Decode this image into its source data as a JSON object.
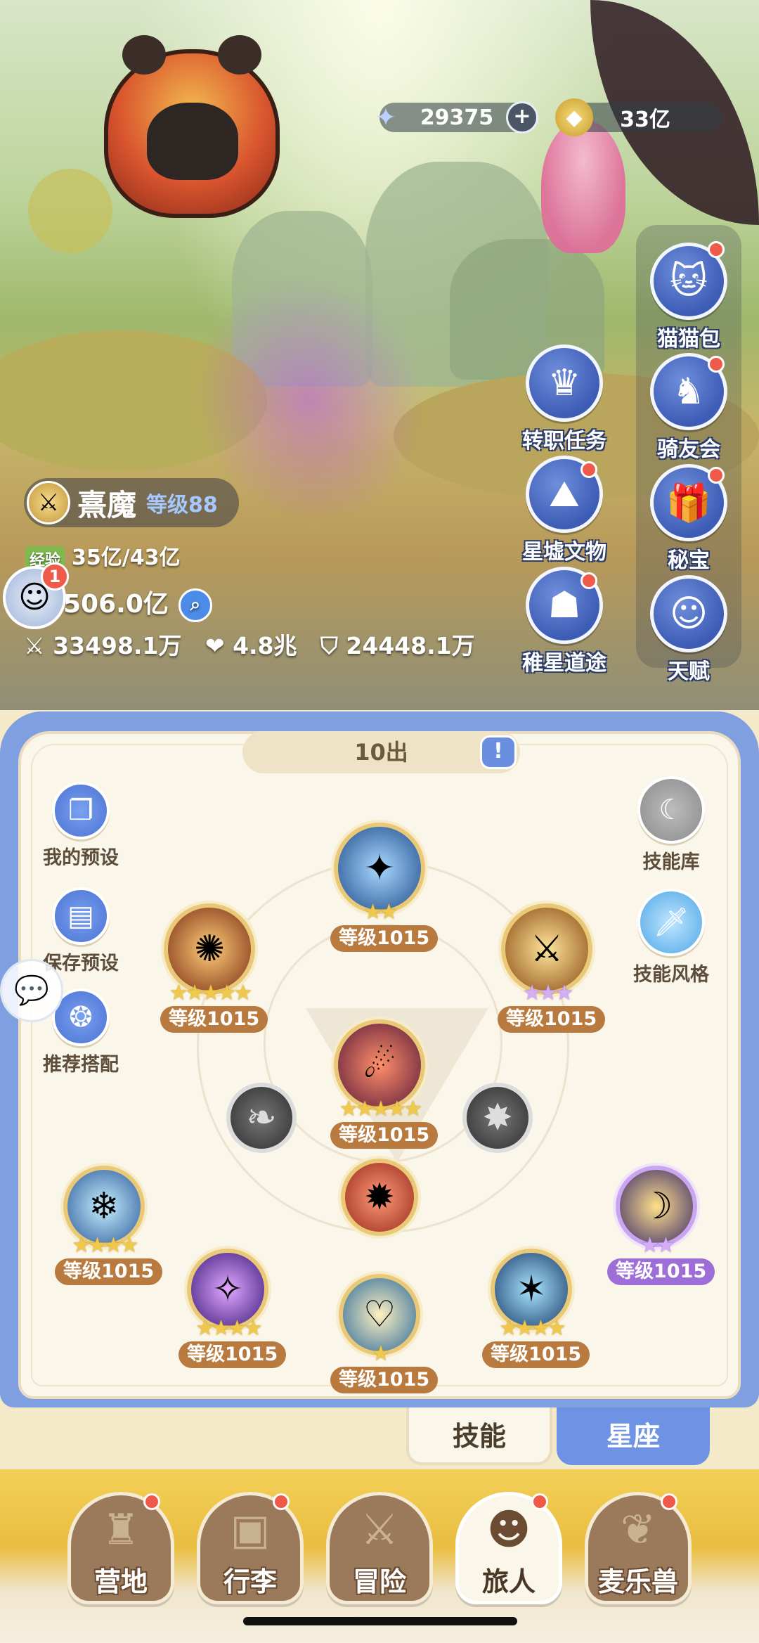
{
  "currencies": {
    "stars": "29375",
    "gold": "33亿",
    "stars_icon": "crystal-star-icon",
    "gold_icon": "gold-coin-icon"
  },
  "side_menu": [
    {
      "label": "猫猫包",
      "icon": "cat-bag-icon",
      "dot": true
    },
    {
      "label": "骑友会",
      "icon": "horse-icon",
      "dot": true
    },
    {
      "label": "秘宝",
      "icon": "treasure-icon",
      "dot": true
    },
    {
      "label": "天赋",
      "icon": "brain-icon",
      "dot": false
    }
  ],
  "mid_menu": [
    {
      "label": "转职任务",
      "icon": "crown-hand-icon",
      "dot": false
    },
    {
      "label": "星墟文物",
      "icon": "ruins-icon",
      "dot": true
    },
    {
      "label": "稚星道途",
      "icon": "hooded-icon",
      "dot": true
    }
  ],
  "player": {
    "name": "熹魔",
    "level": "等级88",
    "exp_label": "经验",
    "exp": "35亿/43亿",
    "power": "506.0亿",
    "attack": "33498.1万",
    "hp": "4.8兆",
    "defense": "24448.1万",
    "notif_count": "1"
  },
  "skills_panel": {
    "count_label": "10出",
    "left_tools": [
      "我的预设",
      "保存预设",
      "推荐搭配"
    ],
    "right_tools": [
      "技能库",
      "技能风格"
    ],
    "skills": [
      {
        "id": "top",
        "level": "等级1015",
        "stars": 2,
        "style": "gold"
      },
      {
        "id": "upper-left",
        "level": "等级1015",
        "stars": 5,
        "style": "gold"
      },
      {
        "id": "upper-right",
        "level": "等级1015",
        "stars": 3,
        "style": "purple"
      },
      {
        "id": "center",
        "level": "等级1015",
        "stars": 5,
        "style": "gold"
      },
      {
        "id": "left-mid",
        "level": "等级1015",
        "stars": 4,
        "style": "gold"
      },
      {
        "id": "right-mid",
        "level": "等级1015",
        "stars": 2,
        "style": "purple"
      },
      {
        "id": "low-left",
        "level": "等级1015",
        "stars": 4,
        "style": "gold"
      },
      {
        "id": "bottom",
        "level": "等级1015",
        "stars": 1,
        "style": "gold"
      },
      {
        "id": "low-right",
        "level": "等级1015",
        "stars": 4,
        "style": "gold"
      }
    ]
  },
  "tabs": {
    "skill": "技能",
    "constellation": "星座"
  },
  "nav": [
    {
      "label": "营地",
      "icon": "castle-icon",
      "dot": true,
      "active": false
    },
    {
      "label": "行李",
      "icon": "luggage-icon",
      "dot": true,
      "active": false
    },
    {
      "label": "冒险",
      "icon": "crossed-swords-icon",
      "dot": false,
      "active": false
    },
    {
      "label": "旅人",
      "icon": "traveler-icon",
      "dot": true,
      "active": true
    },
    {
      "label": "麦乐兽",
      "icon": "fox-icon",
      "dot": true,
      "active": false
    }
  ]
}
